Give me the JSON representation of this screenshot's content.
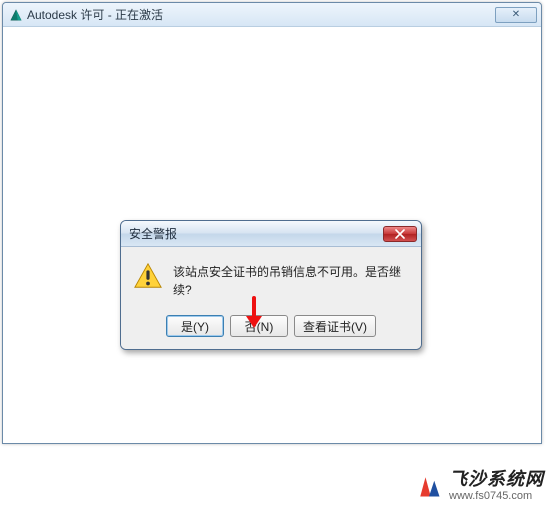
{
  "outer": {
    "title": "Autodesk 许可 - 正在激活",
    "close_label": "✕"
  },
  "dialog": {
    "title": "安全警报",
    "close_label": "✕",
    "message": "该站点安全证书的吊销信息不可用。是否继续?",
    "buttons": {
      "yes": "是(Y)",
      "no": "否(N)",
      "view_cert": "查看证书(V)"
    }
  },
  "watermark": {
    "main": "飞沙系统网",
    "sub": "www.fs0745.com"
  }
}
